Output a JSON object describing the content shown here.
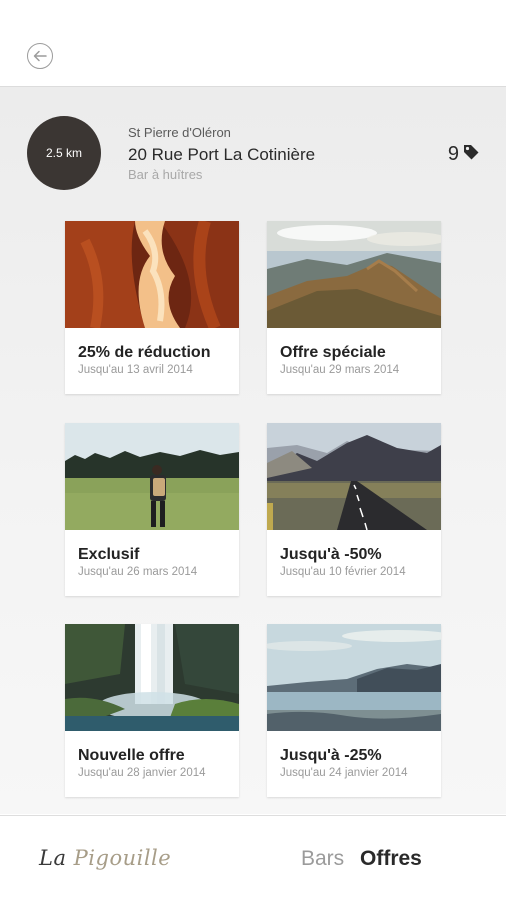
{
  "header": {
    "back_icon": "arrow-left-circle-icon"
  },
  "venue": {
    "distance": "2.5 km",
    "city": "St Pierre d'Oléron",
    "street": "20 Rue Port La Cotinière",
    "type": "Bar à huîtres",
    "offer_count": "9",
    "offer_count_icon": "tag-icon"
  },
  "offers": [
    {
      "title": "25% de réduction",
      "date": "Jusqu'au 13 avril 2014",
      "image": "canyon-photo"
    },
    {
      "title": "Offre spéciale",
      "date": "Jusqu'au 29 mars 2014",
      "image": "mountain-ridge-photo"
    },
    {
      "title": "Exclusif",
      "date": "Jusqu'au 26 mars 2014",
      "image": "hiker-photo"
    },
    {
      "title": "Jusqu'à -50%",
      "date": "Jusqu'au 10 février 2014",
      "image": "road-photo"
    },
    {
      "title": "Nouvelle offre",
      "date": "Jusqu'au 28 janvier 2014",
      "image": "waterfall-photo"
    },
    {
      "title": "Jusqu'à -25%",
      "date": "Jusqu'au 24 janvier 2014",
      "image": "lake-photo"
    }
  ],
  "footer": {
    "logo_part1": "La",
    "logo_part2": "Pigouille",
    "nav_bars": "Bars",
    "nav_offres": "Offres"
  },
  "colors": {
    "distance_circle": "#3b3633",
    "logo_accent": "#a79d88"
  }
}
